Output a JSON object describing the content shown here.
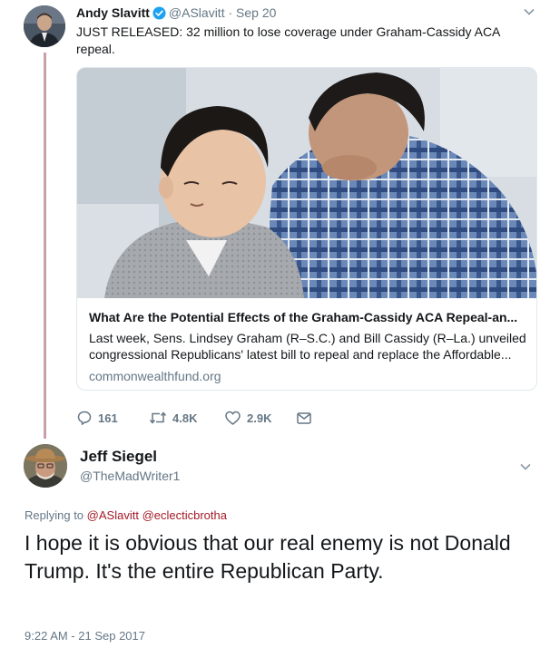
{
  "tweet1": {
    "author_name": "Andy Slavitt",
    "author_handle": "@ASlavitt",
    "separator": "·",
    "date": "Sep 20",
    "text": "JUST RELEASED: 32 million to lose coverage under Graham-Cassidy ACA repeal.",
    "card": {
      "title": "What Are the Potential Effects of the Graham-Cassidy ACA Repeal-an...",
      "description": "Last week, Sens. Lindsey Graham (R–S.C.) and Bill Cassidy (R–La.) unveiled congressional Republicans' latest bill to repeal and replace the Affordable...",
      "domain": "commonwealthfund.org"
    },
    "actions": {
      "replies": "161",
      "retweets": "4.8K",
      "likes": "2.9K"
    },
    "icons": [
      "verified-badge-icon",
      "chevron-down-icon",
      "reply-icon",
      "retweet-icon",
      "like-icon",
      "message-icon"
    ]
  },
  "tweet2": {
    "author_name": "Jeff Siegel",
    "author_handle": "@TheMadWriter1",
    "replying_prefix": "Replying to",
    "replying_to": [
      "@ASlavitt",
      "@eclecticbrotha"
    ],
    "text": "I hope it is obvious that our real enemy is not Donald Trump. It's the entire Republican Party.",
    "timestamp": "9:22 AM - 21 Sep 2017"
  },
  "colors": {
    "text": "#14171a",
    "secondary": "#657786",
    "verified": "#1da1f2",
    "mention": "#a31a28",
    "thread_line": "#c8a0a8",
    "border": "#e1e8ed"
  }
}
